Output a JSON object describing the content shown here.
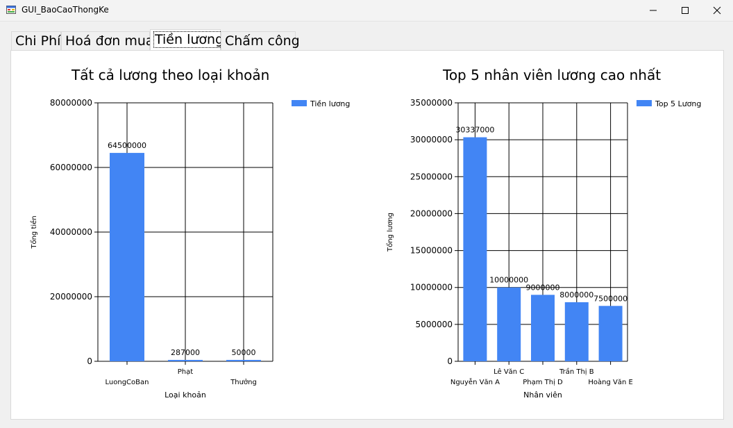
{
  "window": {
    "title": "GUI_BaoCaoThongKe",
    "icon": "app-form-icon"
  },
  "controls": {
    "minimize_icon": "minimize-icon",
    "maximize_icon": "maximize-icon",
    "close_icon": "close-icon"
  },
  "tabs": [
    {
      "label": "Chi Phí",
      "active": false
    },
    {
      "label": "Hoá đơn mua",
      "active": false
    },
    {
      "label": "Tiền lương",
      "active": true
    },
    {
      "label": "Chấm công",
      "active": false
    }
  ],
  "colors": {
    "bar": "#4285f4",
    "grid": "#000000"
  },
  "chart_data": [
    {
      "type": "bar",
      "title": "Tất cả lương theo loại khoản",
      "xlabel": "Loại khoản",
      "ylabel": "Tổng tiền",
      "ylim": [
        0,
        80000000
      ],
      "yticks": [
        "0",
        "20000000",
        "40000000",
        "60000000",
        "80000000"
      ],
      "categories": [
        "LuongCoBan",
        "Phạt",
        "Thưởng"
      ],
      "series": [
        {
          "name": "Tiền lương",
          "values": [
            64500000,
            287000,
            50000
          ]
        }
      ],
      "data_labels": [
        "64500000",
        "287000",
        "50000"
      ],
      "legend": "top-right",
      "grid": true
    },
    {
      "type": "bar",
      "title": "Top 5 nhân viên lương cao nhất",
      "xlabel": "Nhân viên",
      "ylabel": "Tổng lương",
      "ylim": [
        0,
        35000000
      ],
      "yticks": [
        "0",
        "5000000",
        "10000000",
        "15000000",
        "20000000",
        "25000000",
        "30000000",
        "35000000"
      ],
      "categories": [
        "Nguyễn Văn A",
        "Lê Văn C",
        "Phạm Thị D",
        "Trần Thị B",
        "Hoàng Văn E"
      ],
      "series": [
        {
          "name": "Top 5 Lương",
          "values": [
            30337000,
            10000000,
            9000000,
            8000000,
            7500000
          ]
        }
      ],
      "data_labels": [
        "30337000",
        "10000000",
        "9000000",
        "8000000",
        "7500000"
      ],
      "legend": "top-right",
      "grid": true
    }
  ]
}
